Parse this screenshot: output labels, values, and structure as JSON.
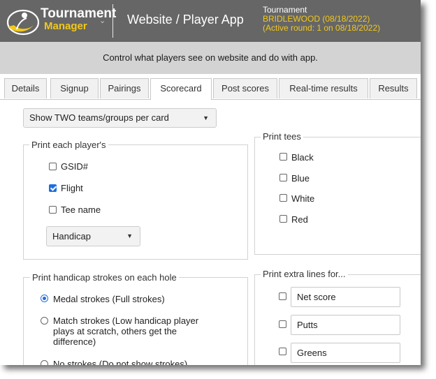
{
  "header": {
    "logo_line1": "Tournament",
    "logo_line2": "Manager",
    "title": "Website / Player App",
    "tournament_label": "Tournament",
    "tournament_name": "BRIDLEWOOD (08/18/2022)",
    "active_round": "(Active round: 1 on 08/18/2022)",
    "accent_color": "#f2c81a",
    "bg_color": "#666666"
  },
  "banner": {
    "text": "Control what players see on website and do with app."
  },
  "tabs": [
    {
      "label": "Details",
      "active": false
    },
    {
      "label": "Signup",
      "active": false
    },
    {
      "label": "Pairings",
      "active": false
    },
    {
      "label": "Scorecard",
      "active": true
    },
    {
      "label": "Post scores",
      "active": false
    },
    {
      "label": "Real-time results",
      "active": false
    },
    {
      "label": "Results",
      "active": false
    }
  ],
  "card_select": {
    "value": "Show TWO teams/groups per card"
  },
  "print_player": {
    "legend": "Print each player's",
    "options": [
      {
        "label": "GSID#",
        "checked": false
      },
      {
        "label": "Flight",
        "checked": true
      },
      {
        "label": "Tee name",
        "checked": false
      }
    ],
    "handicap_select": "Handicap"
  },
  "print_tees": {
    "legend": "Print tees",
    "options": [
      {
        "label": "Black",
        "checked": false
      },
      {
        "label": "Blue",
        "checked": false
      },
      {
        "label": "White",
        "checked": false
      },
      {
        "label": "Red",
        "checked": false
      }
    ]
  },
  "handicap_strokes": {
    "legend": "Print handicap strokes on each hole",
    "options": [
      {
        "label": "Medal strokes (Full strokes)",
        "checked": true
      },
      {
        "label": "Match strokes (Low handicap player plays at scratch, others get the difference)",
        "checked": false
      },
      {
        "label": "No strokes (Do not show strokes)",
        "checked": false
      }
    ]
  },
  "extra_lines": {
    "legend": "Print extra lines for...",
    "items": [
      {
        "value": "Net score",
        "checked": false
      },
      {
        "value": "Putts",
        "checked": false
      },
      {
        "value": "Greens",
        "checked": false
      }
    ]
  },
  "icons": [
    "logo-swirl-icon",
    "chevron-down-icon",
    "dropdown-arrow-icon"
  ]
}
